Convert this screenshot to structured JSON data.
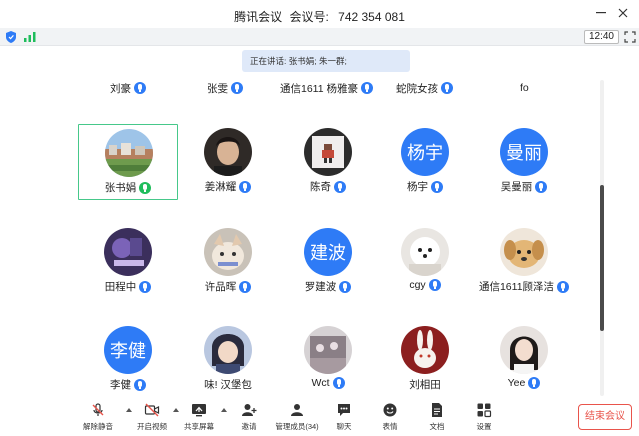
{
  "window": {
    "title": "腾讯会议",
    "meeting_id_label": "会议号:",
    "meeting_id": "742 354 081"
  },
  "status": {
    "time": "12:40"
  },
  "speaking": {
    "text": "正在讲话: 张书娟; 朱一群;"
  },
  "top_row": [
    {
      "name": "刘豪"
    },
    {
      "name": "张雯"
    },
    {
      "name": "通信1611 杨雅豪"
    },
    {
      "name": "蛇院女孩"
    },
    {
      "name": "fo"
    }
  ],
  "participants": [
    {
      "name": "张书娟",
      "avatar": "photo-houses",
      "speaking": true
    },
    {
      "name": "姜淋耀",
      "avatar": "photo-man"
    },
    {
      "name": "陈奇",
      "avatar": "photo-pixel"
    },
    {
      "name": "杨宇",
      "avatar_text": "杨宇"
    },
    {
      "name": "吴曼丽",
      "avatar_text": "曼丽"
    },
    {
      "name": "田程中",
      "avatar": "photo-purple"
    },
    {
      "name": "许品晖",
      "avatar": "photo-cat"
    },
    {
      "name": "罗建波",
      "avatar_text": "建波"
    },
    {
      "name": "cgy",
      "avatar": "photo-dog-white"
    },
    {
      "name": "通信1611顾泽洁",
      "avatar": "photo-puppy"
    },
    {
      "name": "李健",
      "avatar_text": "李健"
    },
    {
      "name": "味! 汉堡包",
      "avatar": "photo-anime"
    },
    {
      "name": "Wct",
      "avatar": "photo-stage"
    },
    {
      "name": "刘相田",
      "avatar": "photo-rabbit"
    },
    {
      "name": "Yee",
      "avatar": "photo-girl"
    }
  ],
  "toolbar": {
    "unmute": "解除静音",
    "video": "开启视频",
    "share": "共享屏幕",
    "invite": "邀请",
    "members": "管理成员(34)",
    "chat": "聊天",
    "reactions": "表情",
    "docs": "文档",
    "settings": "设置",
    "end": "结束会议"
  },
  "colors": {
    "accent": "#2e7bf6",
    "speaking": "#1fbd5c",
    "danger": "#e9544b"
  }
}
